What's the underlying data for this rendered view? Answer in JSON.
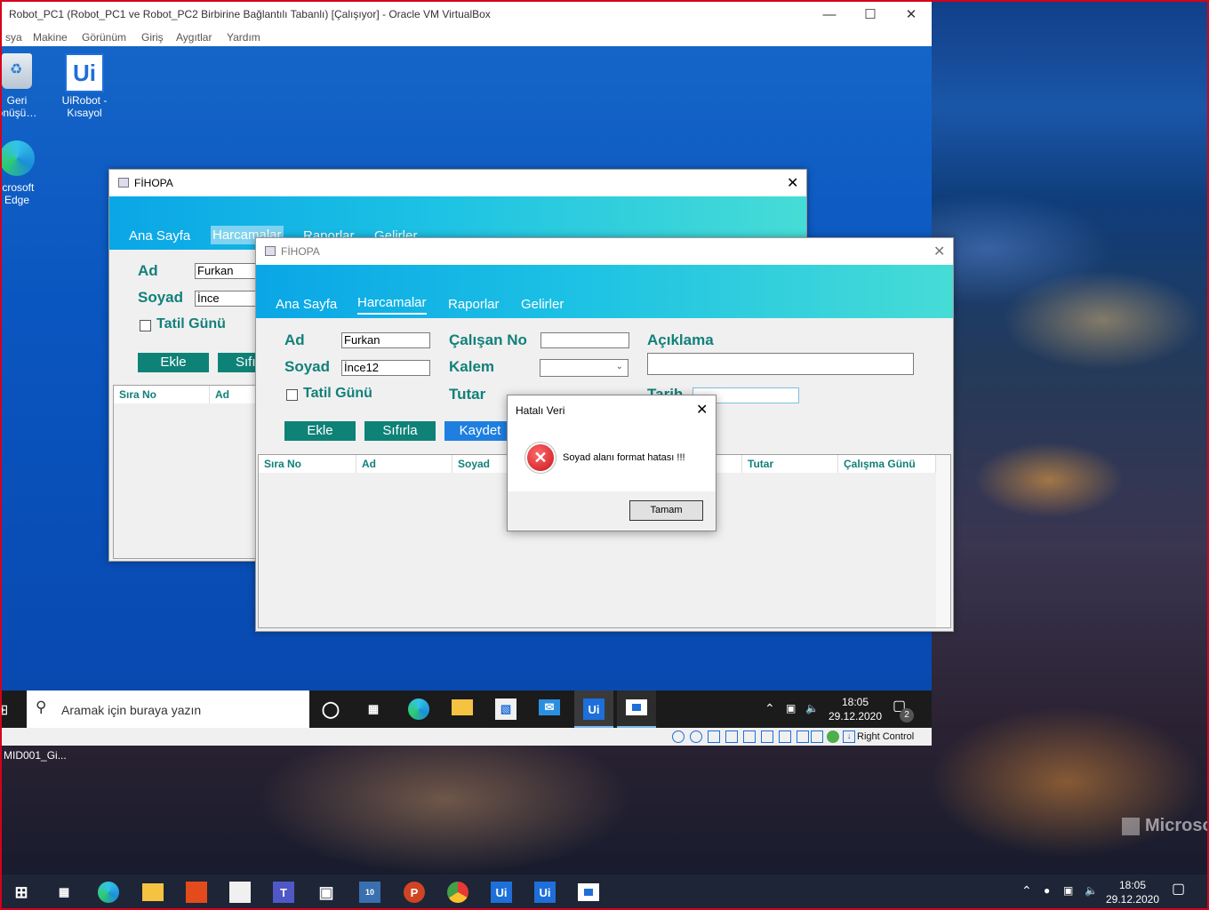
{
  "vm": {
    "title": "Robot_PC1 (Robot_PC1 ve Robot_PC2 Birbirine Bağlantılı Tabanlı) [Çalışıyor] - Oracle VM VirtualBox",
    "menu": [
      "sya",
      "Makine",
      "Görünüm",
      "Giriş",
      "Aygıtlar",
      "Yardım"
    ],
    "status_right": "Right Control"
  },
  "desktop_icons": [
    {
      "label": "Geri\nönüşü…",
      "icon": "recycle-bin-icon"
    },
    {
      "label": "UiRobot -\nKısayol",
      "icon": "uipath-icon"
    },
    {
      "label": "icrosoft\nEdge",
      "icon": "edge-icon"
    }
  ],
  "back_window": {
    "title": "FİHOPA",
    "tabs": [
      "Ana Sayfa",
      "Harcamalar",
      "Raporlar",
      "Gelirler"
    ],
    "ad_label": "Ad",
    "ad_value": "Furkan",
    "soyad_label": "Soyad",
    "soyad_value": "İnce",
    "tatil_label": "Tatil Günü",
    "ekle_label": "Ekle",
    "sifirla_label": "Sıfı",
    "columns": [
      "Sıra No",
      "Ad"
    ]
  },
  "front_window": {
    "title": "FİHOPA",
    "tabs": [
      "Ana Sayfa",
      "Harcamalar",
      "Raporlar",
      "Gelirler"
    ],
    "ad_label": "Ad",
    "ad_value": "Furkan",
    "soyad_label": "Soyad",
    "soyad_value": "İnce12",
    "tatil_label": "Tatil Günü",
    "calisan_label": "Çalışan No",
    "calisan_value": "",
    "kalem_label": "Kalem",
    "kalem_value": "",
    "tutar_label": "Tutar",
    "tarih_label": "Tarih",
    "aciklama_label": "Açıklama",
    "aciklama_value": "",
    "ekle_label": "Ekle",
    "sifirla_label": "Sıfırla",
    "kaydet_label": "Kaydet",
    "columns": [
      "Sıra No",
      "Ad",
      "Soyad",
      "Tutar",
      "Çalışma Günü"
    ]
  },
  "dialog": {
    "title": "Hatalı Veri",
    "message": "Soyad alanı format hatası !!!",
    "ok_label": "Tamam"
  },
  "vm_taskbar": {
    "search_placeholder": "Aramak için buraya yazın",
    "time": "18:05",
    "date": "29.12.2020",
    "notification_count": "2"
  },
  "host": {
    "stray_label": "MID001_Gi...",
    "watermark": "Microso",
    "time": "18:05",
    "date": "29.12.2020"
  },
  "colors": {
    "teal": "#0f8278",
    "band_start": "#0aa6e6",
    "band_end": "#46dcd6",
    "error_red": "#d9252b"
  }
}
